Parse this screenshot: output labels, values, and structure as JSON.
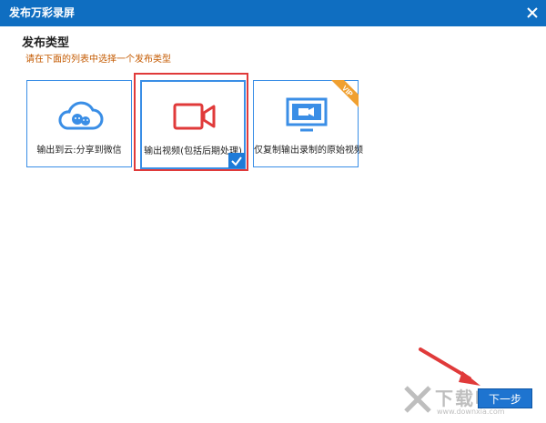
{
  "window": {
    "title": "发布万彩录屏"
  },
  "section": {
    "title": "发布类型",
    "hint": "请在下面的列表中选择一个发布类型"
  },
  "options": [
    {
      "label": "输出到云:分享到微信",
      "icon": "cloud-share-icon"
    },
    {
      "label": "输出视频(包括后期处理)",
      "icon": "video-camera-icon",
      "selected": true
    },
    {
      "label": "仅复制输出录制的原始视频",
      "icon": "monitor-video-icon",
      "badge": "VIP"
    }
  ],
  "footer": {
    "next_label": "下一步"
  },
  "watermark": {
    "text": "下载吧",
    "domain": "www.downxia.com"
  },
  "colors": {
    "titlebar": "#0f6ec1",
    "accent": "#3a8ee6",
    "highlight": "#e03a3a",
    "vip": "#f0a030",
    "hint": "#c45a00"
  }
}
